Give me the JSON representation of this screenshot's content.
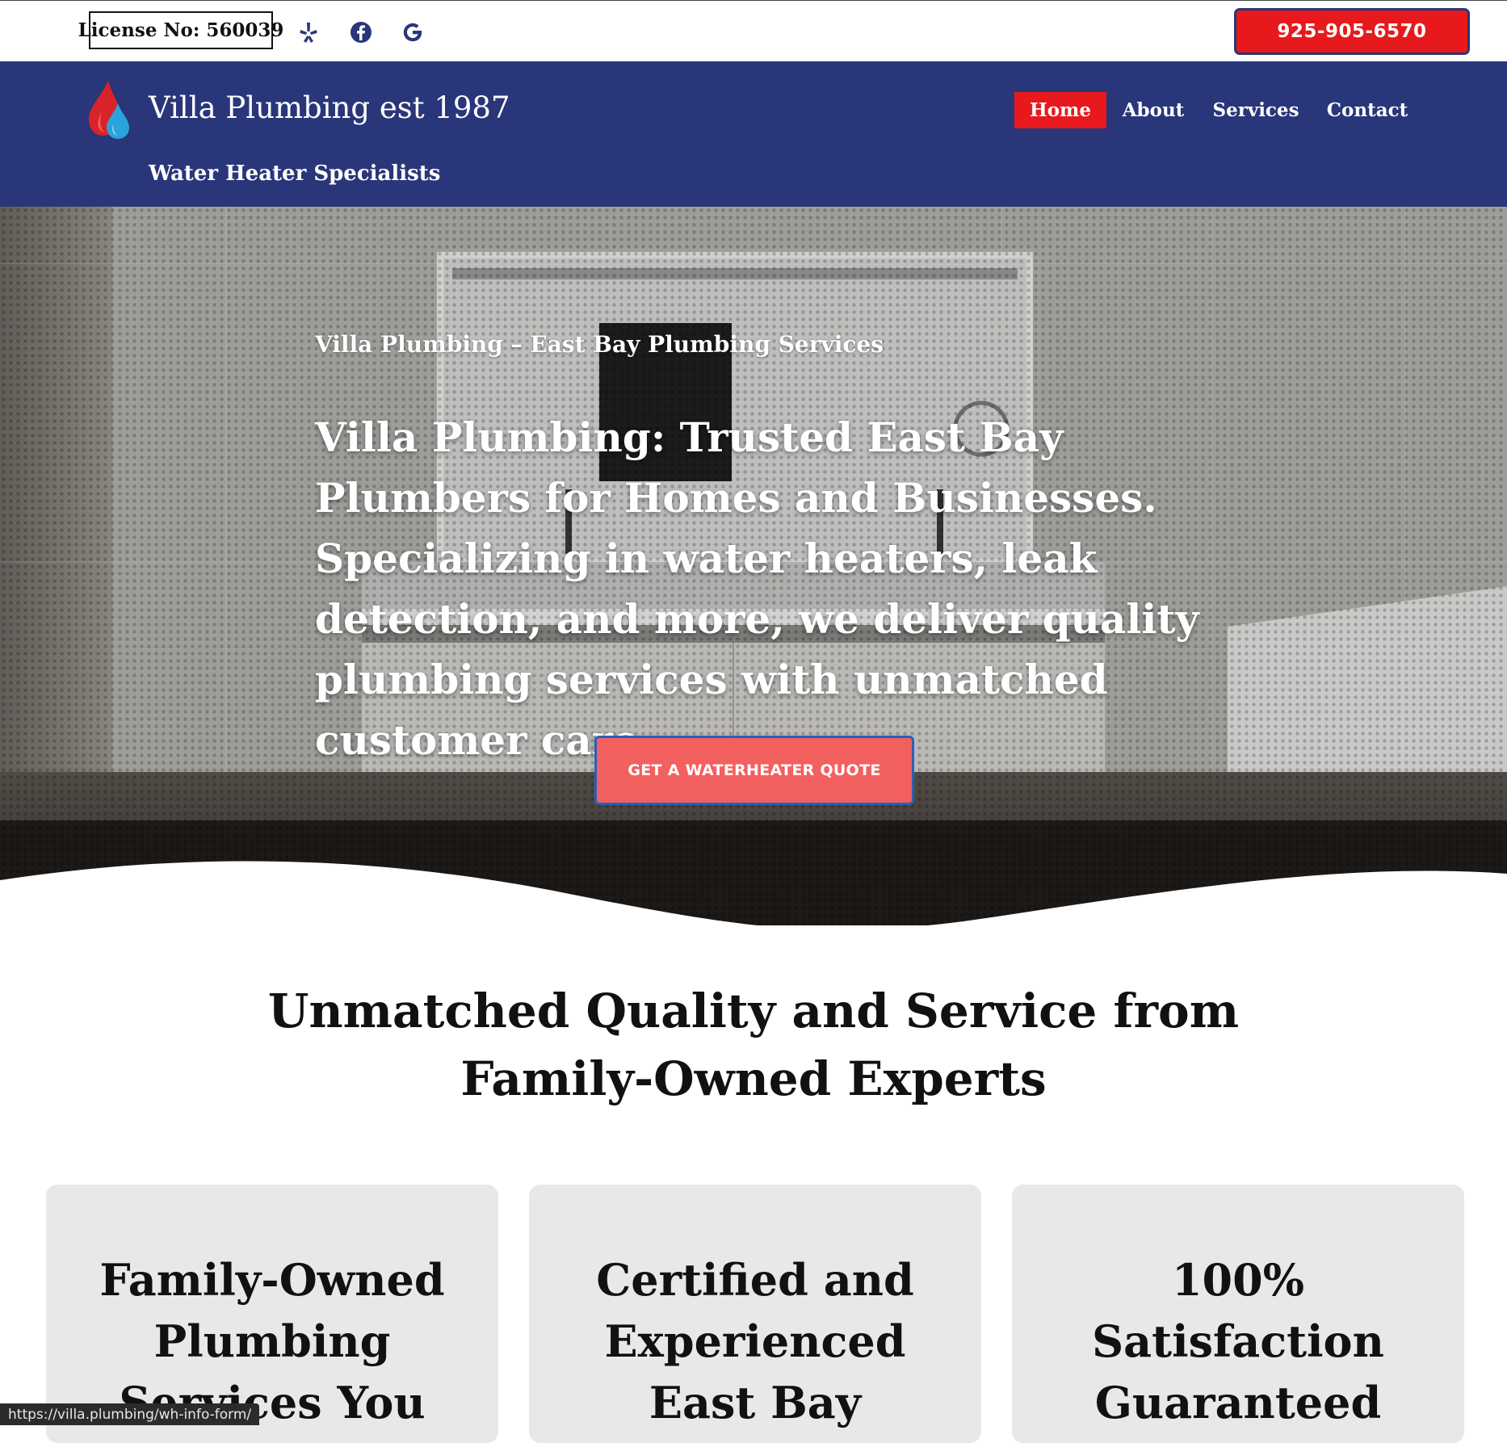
{
  "topbar": {
    "license": "License No: 560039",
    "social_icons": [
      "yelp-icon",
      "facebook-icon",
      "google-icon"
    ],
    "phone": "925-905-6570"
  },
  "header": {
    "site_title": "Villa Plumbing est 1987",
    "tagline": "Water Heater Specialists",
    "nav": [
      "Home",
      "About",
      "Services",
      "Contact"
    ],
    "active_nav": "Home"
  },
  "hero": {
    "eyebrow": "Villa Plumbing – East Bay Plumbing Services",
    "title": "Villa Plumbing: Trusted East Bay Plumbers for Homes and Businesses. Specializing in water heaters, leak detection, and more, we deliver quality plumbing services with unmatched customer care.",
    "cta": "GET A WATERHEATER QUOTE"
  },
  "features": {
    "heading": "Unmatched Quality and Service from Family-Owned Experts",
    "cards": [
      {
        "title": "Family-Owned Plumbing Services You"
      },
      {
        "title": "Certified and Experienced East Bay"
      },
      {
        "title": "100% Satisfaction Guaranteed"
      }
    ]
  },
  "status_bar": {
    "url": "https://villa.plumbing/wh-info-form/"
  },
  "colors": {
    "brand_blue": "#2a367a",
    "accent_red": "#e8191d",
    "cta_coral": "#f2605f",
    "card_gray": "#e8e8e8"
  }
}
